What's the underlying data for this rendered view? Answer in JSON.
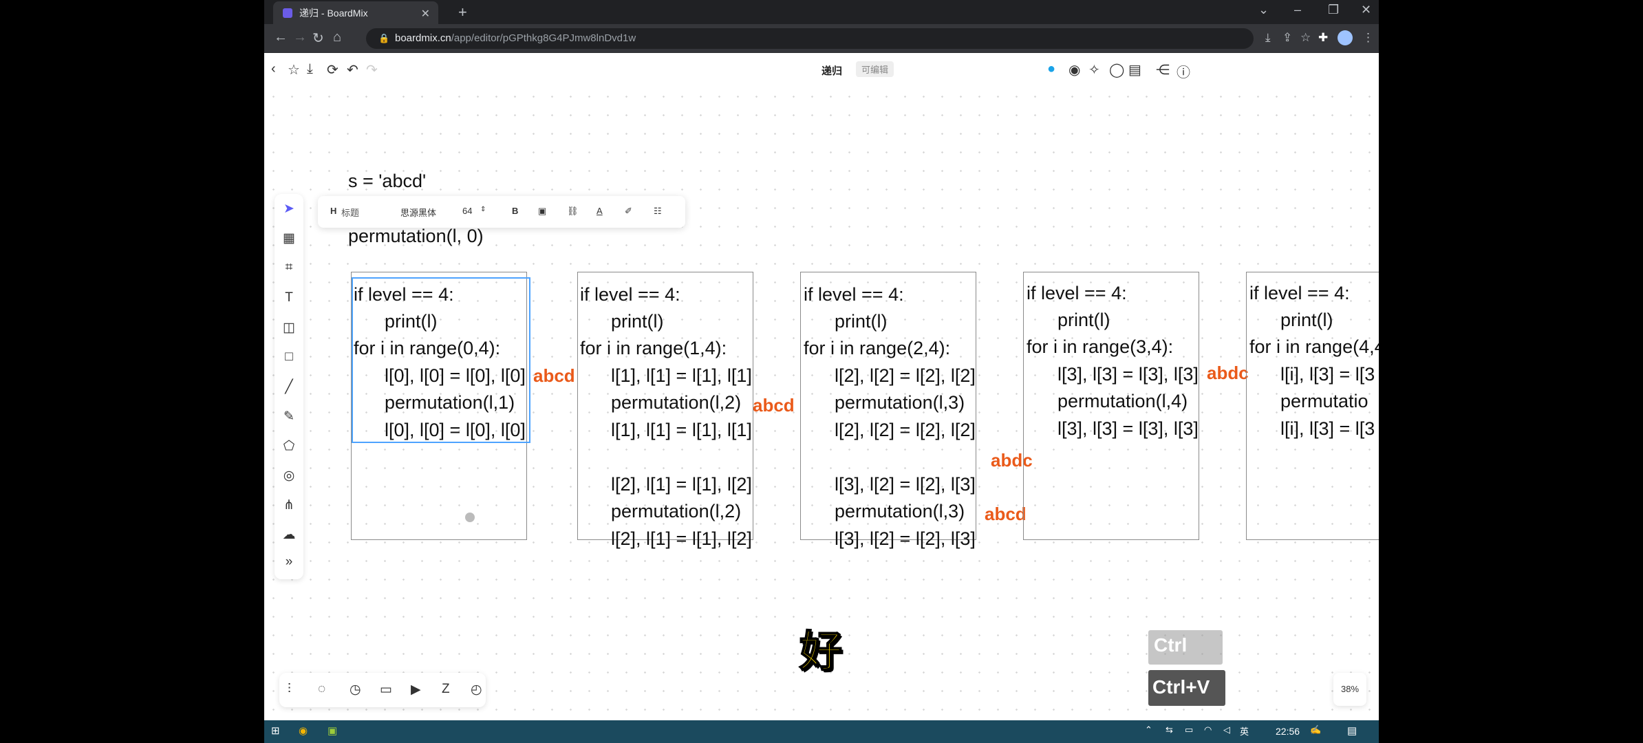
{
  "browser": {
    "tab_title": "递归 - BoardMix",
    "url_host": "boardmix.cn",
    "url_path": "/app/editor/pGPthkg8G4PJmw8lnDvd1w"
  },
  "app": {
    "doc_title": "递归",
    "edit_badge": "可编辑"
  },
  "format_toolbar": {
    "heading": "H",
    "heading_style": "标题",
    "font_name": "思源黑体",
    "font_size": "64",
    "bold": "B"
  },
  "canvas": {
    "line1": "s = 'abcd'",
    "line2": "permutation(l, 0)",
    "frames": [
      {
        "lines": [
          "if level == 4:",
          "      print(l)",
          "for i in range(0,4):",
          "      l[0], l[0] = l[0], l[0]",
          "      permutation(l,1)",
          "      l[0], l[0] = l[0], l[0]"
        ]
      },
      {
        "lines": [
          "if level == 4:",
          "      print(l)",
          "for i in range(1,4):",
          "      l[1], l[1] = l[1], l[1]",
          "      permutation(l,2)",
          "      l[1], l[1] = l[1], l[1]",
          "",
          "      l[2], l[1] = l[1], l[2]",
          "      permutation(l,2)",
          "      l[2], l[1] = l[1], l[2]"
        ]
      },
      {
        "lines": [
          "if level == 4:",
          "      print(l)",
          "for i in range(2,4):",
          "      l[2], l[2] = l[2], l[2]",
          "      permutation(l,3)",
          "      l[2], l[2] = l[2], l[2]",
          "",
          "      l[3], l[2] = l[2], l[3]",
          "      permutation(l,3)",
          "      l[3], l[2] = l[2], l[3]"
        ]
      },
      {
        "lines": [
          "if level == 4:",
          "      print(l)",
          "for i in range(3,4):",
          "      l[3], l[3] = l[3], l[3]",
          "      permutation(l,4)",
          "      l[3], l[3] = l[3], l[3]"
        ]
      },
      {
        "lines": [
          "if level == 4:",
          "      print(l)",
          "for i in range(4,4",
          "      l[i], l[3] = l[3",
          "      permutatio",
          "      l[i], l[3] = l[3"
        ]
      }
    ],
    "annotations": [
      "abcd",
      "abcd",
      "abdc",
      "abcd",
      "abdc"
    ]
  },
  "overlay": {
    "subtitle": "好",
    "ctrl_c": "Ctrl",
    "ctrl_v": "Ctrl+V",
    "zoom": "38%"
  },
  "taskbar": {
    "ime": "英",
    "time": "22:56"
  },
  "colors": {
    "accent": "#5b5bf5",
    "annotation": "#ea5a1a",
    "selection": "#4da3ff"
  }
}
